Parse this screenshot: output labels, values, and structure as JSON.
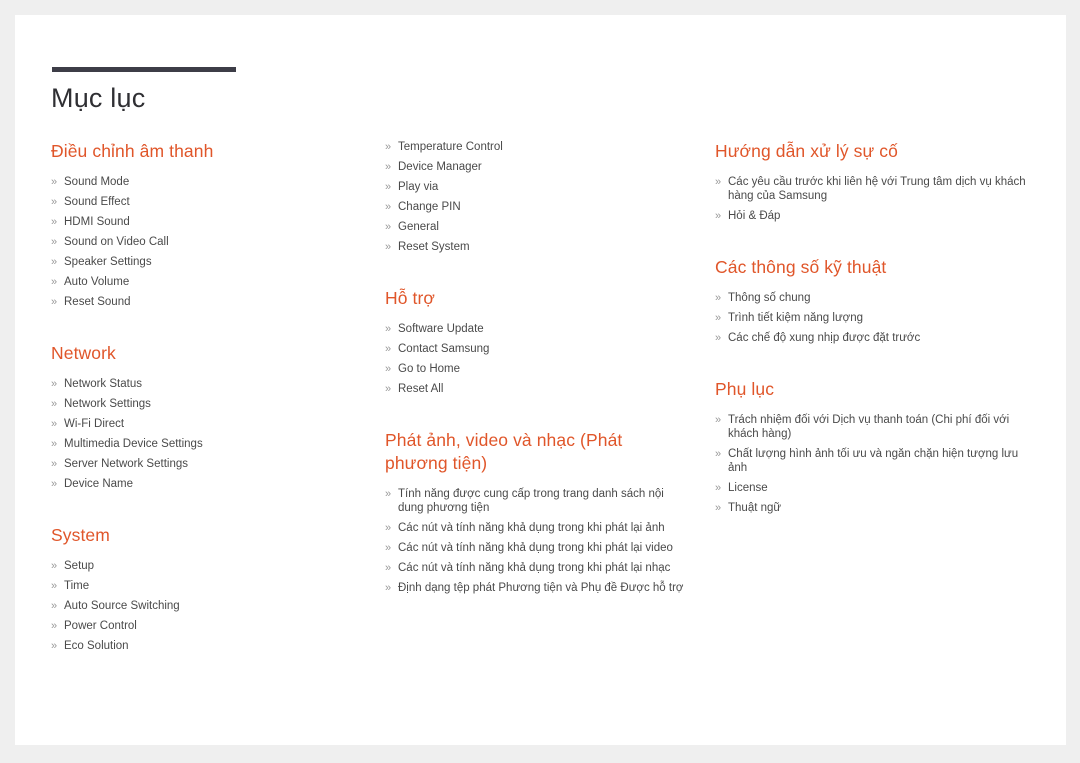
{
  "page": {
    "title": "Mục lục",
    "accent_color": "#e0562a",
    "rule_color": "#3d3d47",
    "text_color": "#4a4a4a",
    "bullet_glyph": "»",
    "background_color": "#efefef",
    "page_color": "#ffffff"
  },
  "columns": [
    {
      "sections": [
        {
          "heading": "Điều chỉnh âm thanh",
          "has_heading": true,
          "items": [
            {
              "text": "Sound Mode"
            },
            {
              "text": "Sound Effect"
            },
            {
              "text": "HDMI Sound"
            },
            {
              "text": "Sound on Video Call"
            },
            {
              "text": "Speaker Settings"
            },
            {
              "text": "Auto Volume"
            },
            {
              "text": "Reset Sound"
            }
          ]
        },
        {
          "heading": "Network",
          "has_heading": true,
          "items": [
            {
              "text": "Network Status"
            },
            {
              "text": "Network Settings"
            },
            {
              "text": "Wi-Fi Direct"
            },
            {
              "text": "Multimedia Device Settings"
            },
            {
              "text": "Server Network Settings"
            },
            {
              "text": "Device Name"
            }
          ]
        },
        {
          "heading": "System",
          "has_heading": true,
          "items": [
            {
              "text": "Setup"
            },
            {
              "text": "Time"
            },
            {
              "text": "Auto Source Switching"
            },
            {
              "text": "Power Control"
            },
            {
              "text": "Eco Solution"
            }
          ]
        }
      ]
    },
    {
      "sections": [
        {
          "heading": "",
          "has_heading": false,
          "items": [
            {
              "text": "Temperature Control"
            },
            {
              "text": "Device Manager"
            },
            {
              "text": "Play via"
            },
            {
              "text": "Change PIN"
            },
            {
              "text": "General"
            },
            {
              "text": "Reset System"
            }
          ]
        },
        {
          "heading": "Hỗ trợ",
          "has_heading": true,
          "items": [
            {
              "text": "Software Update"
            },
            {
              "text": "Contact Samsung"
            },
            {
              "text": "Go to Home"
            },
            {
              "text": "Reset All"
            }
          ]
        },
        {
          "heading": "Phát ảnh, video và nhạc (Phát phương tiện)",
          "has_heading": true,
          "items": [
            {
              "text": "Tính năng được cung cấp trong trang danh sách nội dung phương tiện"
            },
            {
              "text": "Các nút và tính năng khả dụng trong khi phát lại ảnh"
            },
            {
              "text": "Các nút và tính năng khả dụng trong khi phát lại video"
            },
            {
              "text": "Các nút và tính năng khả dụng trong khi phát lại nhạc"
            },
            {
              "text": "Định dạng tệp phát Phương tiện và Phụ đề Được hỗ trợ"
            }
          ]
        }
      ]
    },
    {
      "sections": [
        {
          "heading": "Hướng dẫn xử lý sự cố",
          "has_heading": true,
          "items": [
            {
              "text": "Các yêu cầu trước khi liên hệ với Trung tâm dịch vụ khách hàng của Samsung"
            },
            {
              "text": "Hỏi & Đáp"
            }
          ]
        },
        {
          "heading": "Các thông số kỹ thuật",
          "has_heading": true,
          "items": [
            {
              "text": "Thông số chung"
            },
            {
              "text": "Trình tiết kiệm năng lượng"
            },
            {
              "text": "Các chế độ xung nhịp được đặt trước"
            }
          ]
        },
        {
          "heading": "Phụ lục",
          "has_heading": true,
          "items": [
            {
              "text": "Trách nhiệm đối với Dịch vụ thanh toán (Chi phí đối với khách hàng)"
            },
            {
              "text": "Chất lượng hình ảnh tối ưu và ngăn chặn hiện tượng lưu ảnh"
            },
            {
              "text": "License"
            },
            {
              "text": "Thuật ngữ"
            }
          ]
        }
      ]
    }
  ]
}
